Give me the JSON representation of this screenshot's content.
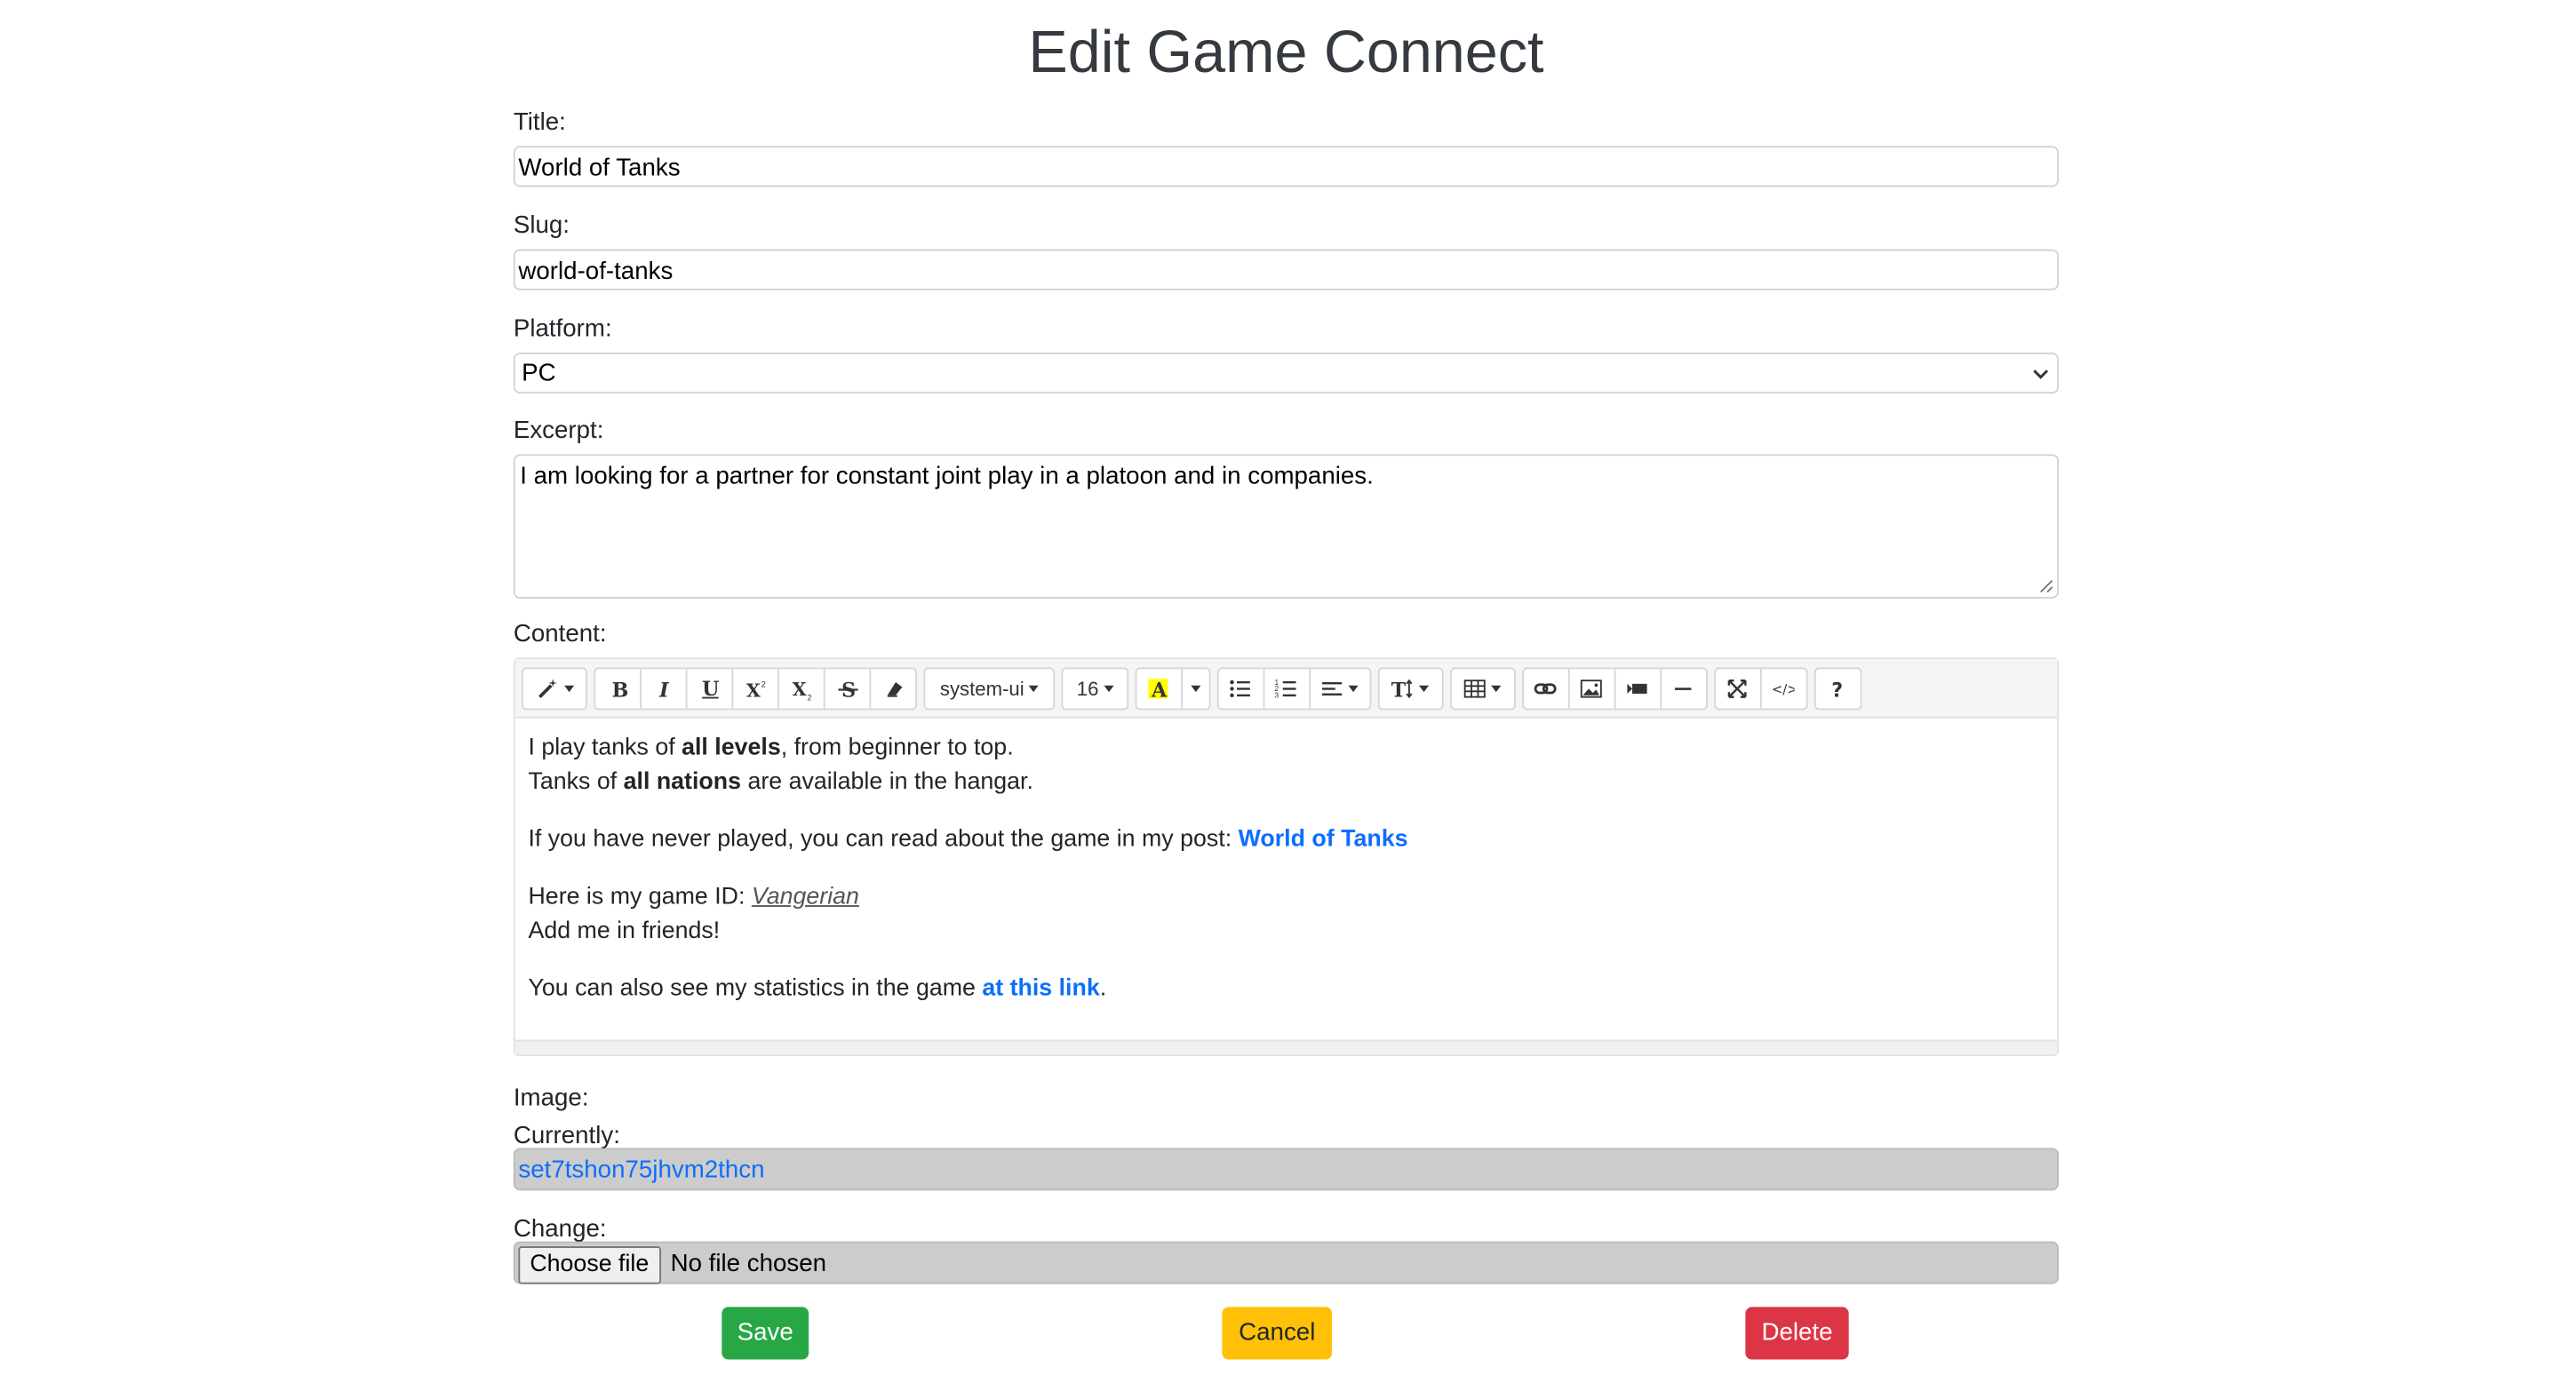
{
  "page": {
    "title": "Edit Game Connect"
  },
  "form": {
    "title_label": "Title:",
    "title_value": "World of Tanks",
    "slug_label": "Slug:",
    "slug_value": "world-of-tanks",
    "platform_label": "Platform:",
    "platform_value": "PC",
    "excerpt_label": "Excerpt:",
    "excerpt_value": "I am looking for a partner for constant joint play in a platoon and in companies.",
    "content_label": "Content:",
    "image_label": "Image:",
    "currently_label": "Currently:",
    "currently_value": "set7tshon75jhvm2thcn",
    "change_label": "Change:",
    "choose_file_label": "Choose file",
    "no_file_label": "No file chosen"
  },
  "editor": {
    "font_name": "system-ui",
    "font_size": "16",
    "toolbar_icons": [
      "magic-icon",
      "bold-icon",
      "italic-icon",
      "underline-icon",
      "superscript-icon",
      "subscript-icon",
      "strikethrough-icon",
      "eraser-icon",
      "font-color-icon",
      "unordered-list-icon",
      "ordered-list-icon",
      "align-icon",
      "text-height-icon",
      "table-icon",
      "link-icon",
      "picture-icon",
      "video-icon",
      "horizontal-rule-icon",
      "fullscreen-icon",
      "code-view-icon",
      "help-icon"
    ],
    "highlight_color": "#ffff00",
    "content": {
      "p1_a": "I play tanks of ",
      "p1_b": "all levels",
      "p1_c": ", from beginner to top.",
      "p1_d": "Tanks of ",
      "p1_e": "all nations",
      "p1_f": " are available in the hangar.",
      "p2_a": "If you have never played, you can read about the game in my post: ",
      "p2_link": "World of Tanks",
      "p3_a": "Here is my game ID: ",
      "p3_id": "Vangerian",
      "p3_b": "Add me in friends!",
      "p4_a": "You can also see my statistics in the game ",
      "p4_link": "at this link",
      "p4_b": "."
    }
  },
  "actions": {
    "save": "Save",
    "cancel": "Cancel",
    "delete": "Delete"
  },
  "colors": {
    "save": "#28a745",
    "cancel": "#ffc107",
    "delete": "#dc3545",
    "link": "#0d6efd"
  }
}
